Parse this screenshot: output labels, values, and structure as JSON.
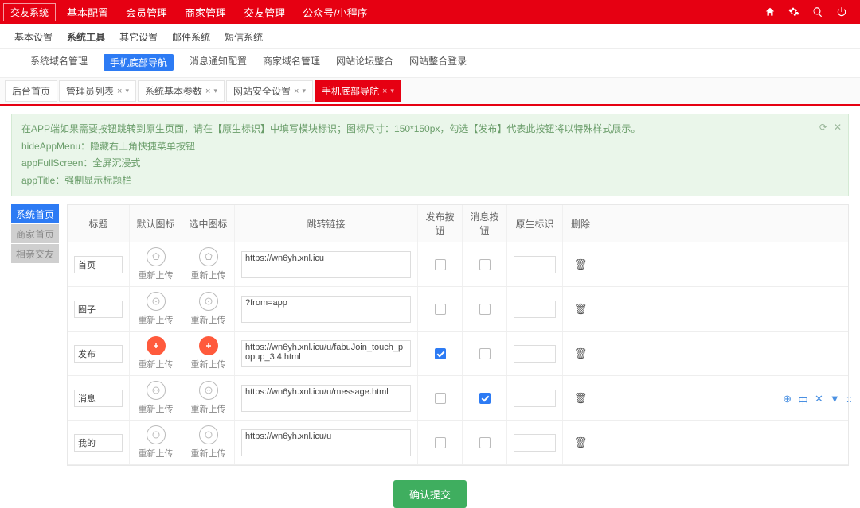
{
  "topbar": {
    "system": "交友系统",
    "menu": [
      "基本配置",
      "会员管理",
      "商家管理",
      "交友管理",
      "公众号/小程序"
    ],
    "icons": [
      "home",
      "gear",
      "search",
      "power"
    ]
  },
  "subtabs": {
    "items": [
      "基本设置",
      "系统工具",
      "其它设置",
      "邮件系统",
      "短信系统"
    ],
    "active": 1
  },
  "subtabs2": {
    "items": [
      "系统域名管理",
      "手机底部导航",
      "消息通知配置",
      "商家域名管理",
      "网站论坛整合",
      "网站整合登录"
    ],
    "active": 1
  },
  "breadcrumb": [
    {
      "label": "后台首页",
      "close": false
    },
    {
      "label": "管理员列表",
      "close": true,
      "caret": true
    },
    {
      "label": "系统基本参数",
      "close": true,
      "caret": true
    },
    {
      "label": "网站安全设置",
      "close": true,
      "caret": true
    },
    {
      "label": "手机底部导航",
      "close": true,
      "caret": true,
      "active": true
    }
  ],
  "info": {
    "l1": "在APP端如果需要按钮跳转到原生页面，请在【原生标识】中填写模块标识；图标尺寸：150*150px，勾选【发布】代表此按钮将以特殊样式展示。",
    "l2": "hideAppMenu：隐藏右上角快捷菜单按钮",
    "l3": "appFullScreen：全屏沉浸式",
    "l4": "appTitle：强制显示标题栏",
    "closeIcons": [
      "⟳",
      "✕"
    ]
  },
  "side": [
    "系统首页",
    "商家首页",
    "相亲交友"
  ],
  "table": {
    "headers": [
      "标题",
      "默认图标",
      "选中图标",
      "跳转链接",
      "发布按钮",
      "消息按钮",
      "原生标识",
      "删除"
    ],
    "reupload": "重新上传",
    "rows": [
      {
        "title": "首页",
        "iconShape": "pentagon",
        "link": "https://wn6yh.xnl.icu",
        "pub": false,
        "msg": false,
        "native": ""
      },
      {
        "title": "圈子",
        "iconShape": "target",
        "link": "?from=app",
        "pub": false,
        "msg": false,
        "native": ""
      },
      {
        "title": "发布",
        "iconShape": "plus",
        "iconFilled": true,
        "link": "https://wn6yh.xnl.icu/u/fabuJoin_touch_popup_3.4.html",
        "pub": true,
        "msg": false,
        "native": ""
      },
      {
        "title": "消息",
        "iconShape": "dots",
        "link": "https://wn6yh.xnl.icu/u/message.html",
        "pub": false,
        "msg": true,
        "native": ""
      },
      {
        "title": "我的",
        "iconShape": "circle",
        "link": "https://wn6yh.xnl.icu/u",
        "pub": false,
        "msg": false,
        "native": ""
      }
    ]
  },
  "submit": "确认提交",
  "status": [
    "⊕",
    "中",
    "✕",
    "▼",
    "::"
  ]
}
